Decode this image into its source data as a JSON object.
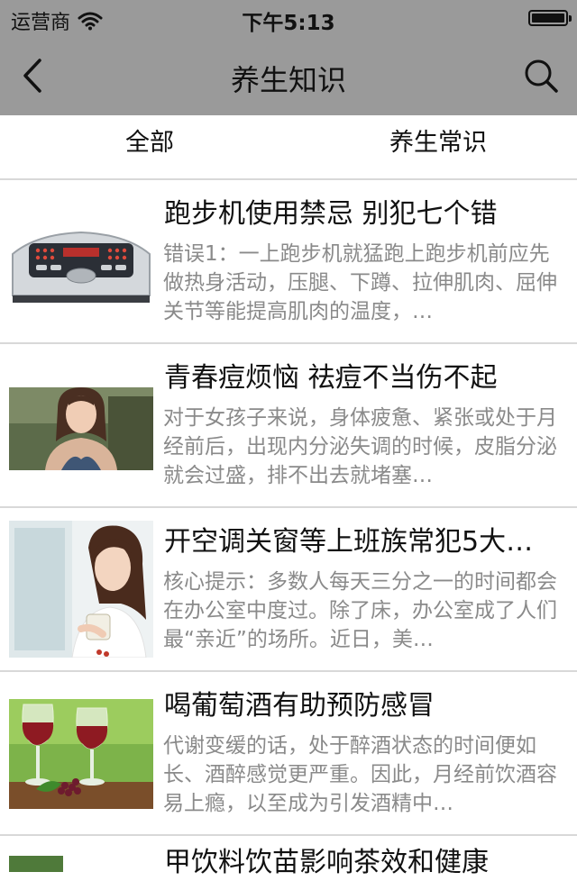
{
  "status_bar": {
    "carrier": "运营商",
    "time": "下午5:13",
    "battery_level": 1.0
  },
  "nav": {
    "title": "养生知识",
    "back_icon": "chevron-left-icon",
    "search_icon": "search-icon"
  },
  "tabs": [
    {
      "label": "全部"
    },
    {
      "label": "养生常识"
    }
  ],
  "articles": [
    {
      "title": "跑步机使用禁忌 别犯七个错",
      "summary": "错误1：一上跑步机就猛跑上跑步机前应先做热身活动，压腿、下蹲、拉伸肌肉、屈伸关节等能提高肌肉的温度，…",
      "thumbnail": "treadmill-console-image"
    },
    {
      "title": "青春痘烦恼 祛痘不当伤不起",
      "summary": "对于女孩子来说，身体疲惫、紧张或处于月经前后，出现内分泌失调的时候，皮脂分泌就会过盛，排不出去就堵塞…",
      "thumbnail": "woman-portrait-image"
    },
    {
      "title": "开空调关窗等上班族常犯5大…",
      "summary": "核心提示：多数人每天三分之一的时间都会在办公室中度过。除了床，办公室成了人们最“亲近”的场所。近日，美…",
      "thumbnail": "woman-with-cup-image"
    },
    {
      "title": "喝葡萄酒有助预防感冒",
      "summary": " 代谢变缓的话，处于醉酒状态的时间便如长、酒醉感觉更严重。因此，月经前饮酒容易上瘾，以至成为引发酒精中…",
      "thumbnail": "wine-glasses-image"
    },
    {
      "title": "甲饮料饮苗影响茶效和健康",
      "summary": "",
      "thumbnail": "partial-thumbnail-image"
    }
  ]
}
